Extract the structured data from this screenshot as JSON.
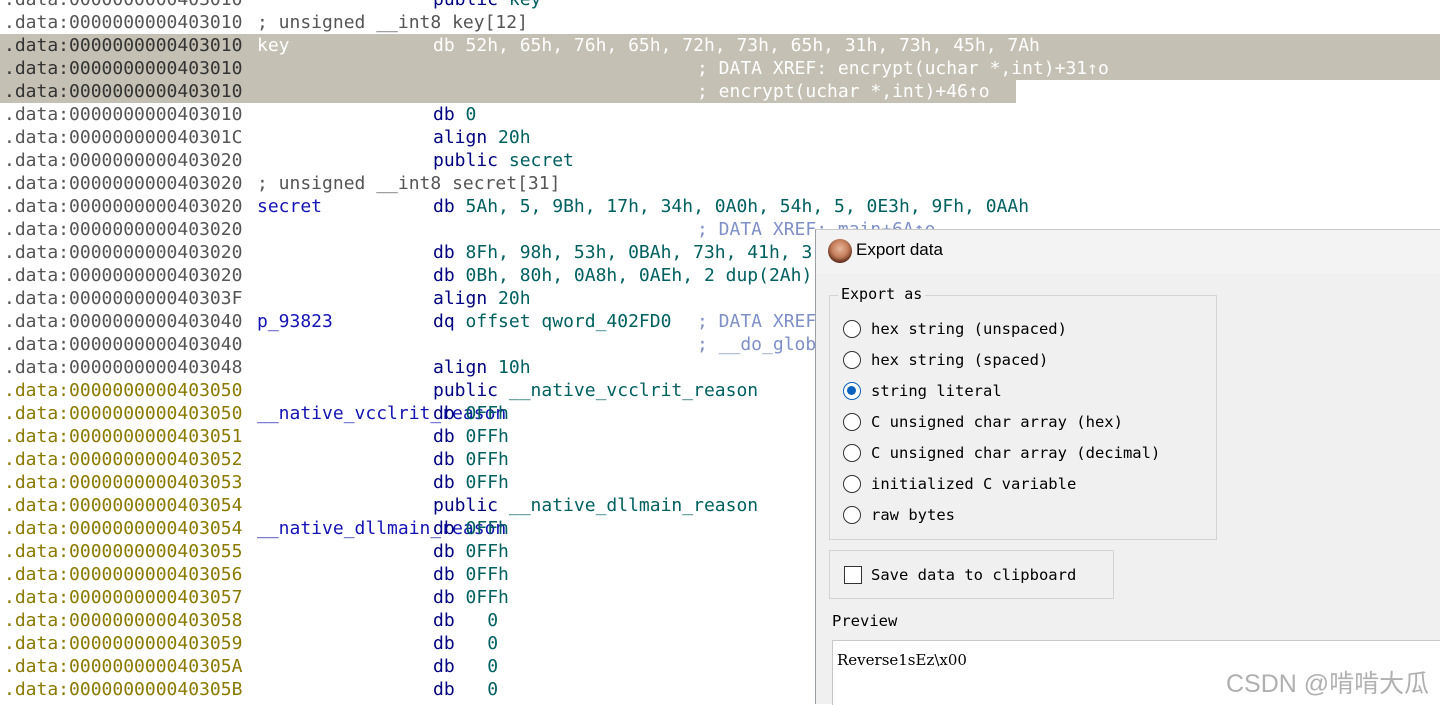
{
  "listing": {
    "lines": [
      {
        "addr": ".data:0000000000403010",
        "label": "",
        "decl": "",
        "ins": "public",
        "op": "key",
        "xref": ""
      },
      {
        "addr": ".data:0000000000403010",
        "label": "",
        "decl": "; unsigned __int8 key[12]",
        "ins": "",
        "op": "",
        "xref": ""
      },
      {
        "addr": ".data:0000000000403010",
        "label": "key",
        "decl": "",
        "ins": "db",
        "op": "52h, 65h, 76h, 65h, 72h, 73h, 65h, 31h, 73h, 45h, 7Ah",
        "xref": ""
      },
      {
        "addr": ".data:0000000000403010",
        "label": "",
        "decl": "",
        "ins": "",
        "op": "",
        "xref": "; DATA XREF: encrypt(uchar *,int)+31↑o"
      },
      {
        "addr": ".data:0000000000403010",
        "label": "",
        "decl": "",
        "ins": "",
        "op": "",
        "xref": "; encrypt(uchar *,int)+46↑o"
      },
      {
        "addr": ".data:0000000000403010",
        "label": "",
        "decl": "",
        "ins": "db",
        "op": "0",
        "xref": ""
      },
      {
        "addr": ".data:000000000040301C",
        "label": "",
        "decl": "",
        "ins": "align",
        "op": "20h",
        "xref": ""
      },
      {
        "addr": ".data:0000000000403020",
        "label": "",
        "decl": "",
        "ins": "public",
        "op": "secret",
        "xref": ""
      },
      {
        "addr": ".data:0000000000403020",
        "label": "",
        "decl": "; unsigned __int8 secret[31]",
        "ins": "",
        "op": "",
        "xref": ""
      },
      {
        "addr": ".data:0000000000403020",
        "label": "secret",
        "decl": "",
        "ins": "db",
        "op": "5Ah, 5, 9Bh, 17h, 34h, 0A0h, 54h, 5, 0E3h, 9Fh, 0AAh",
        "xref": ""
      },
      {
        "addr": ".data:0000000000403020",
        "label": "",
        "decl": "",
        "ins": "",
        "op": "",
        "xref": "; DATA XREF: main+6A↑o"
      },
      {
        "addr": ".data:0000000000403020",
        "label": "",
        "decl": "",
        "ins": "db",
        "op": "8Fh, 98h, 53h, 0BAh, 73h, 41h, 3",
        "xref": ""
      },
      {
        "addr": ".data:0000000000403020",
        "label": "",
        "decl": "",
        "ins": "db",
        "op": "0Bh, 80h, 0A8h, 0AEh, 2 dup(2Ah)",
        "xref": ""
      },
      {
        "addr": ".data:000000000040303F",
        "label": "",
        "decl": "",
        "ins": "align",
        "op": "20h",
        "xref": ""
      },
      {
        "addr": ".data:0000000000403040",
        "label": "p_93823",
        "decl": "",
        "ins": "dq",
        "op": "offset qword_402FD0",
        "xref": "; DATA XREF"
      },
      {
        "addr": ".data:0000000000403040",
        "label": "",
        "decl": "",
        "ins": "",
        "op": "",
        "xref": "; __do_glob"
      },
      {
        "addr": ".data:0000000000403048",
        "label": "",
        "decl": "",
        "ins": "align",
        "op": "10h",
        "xref": ""
      },
      {
        "addr": ".data:0000000000403050",
        "label": "",
        "decl": "",
        "ins": "public",
        "op": "__native_vcclrit_reason",
        "xref": ""
      },
      {
        "addr": ".data:0000000000403050",
        "label": "__native_vcclrit_reason",
        "decl": "",
        "ins": "db",
        "op": "0FFh",
        "xref": ""
      },
      {
        "addr": ".data:0000000000403051",
        "label": "",
        "decl": "",
        "ins": "db",
        "op": "0FFh",
        "xref": ""
      },
      {
        "addr": ".data:0000000000403052",
        "label": "",
        "decl": "",
        "ins": "db",
        "op": "0FFh",
        "xref": ""
      },
      {
        "addr": ".data:0000000000403053",
        "label": "",
        "decl": "",
        "ins": "db",
        "op": "0FFh",
        "xref": ""
      },
      {
        "addr": ".data:0000000000403054",
        "label": "",
        "decl": "",
        "ins": "public",
        "op": "__native_dllmain_reason",
        "xref": ""
      },
      {
        "addr": ".data:0000000000403054",
        "label": "__native_dllmain_reason",
        "decl": "",
        "ins": "db",
        "op": "0FFh",
        "xref": ""
      },
      {
        "addr": ".data:0000000000403055",
        "label": "",
        "decl": "",
        "ins": "db",
        "op": "0FFh",
        "xref": ""
      },
      {
        "addr": ".data:0000000000403056",
        "label": "",
        "decl": "",
        "ins": "db",
        "op": "0FFh",
        "xref": ""
      },
      {
        "addr": ".data:0000000000403057",
        "label": "",
        "decl": "",
        "ins": "db",
        "op": "0FFh",
        "xref": ""
      },
      {
        "addr": ".data:0000000000403058",
        "label": "",
        "decl": "",
        "ins": "db",
        "op": "  0",
        "xref": ""
      },
      {
        "addr": ".data:0000000000403059",
        "label": "",
        "decl": "",
        "ins": "db",
        "op": "  0",
        "xref": ""
      },
      {
        "addr": ".data:000000000040305A",
        "label": "",
        "decl": "",
        "ins": "db",
        "op": "  0",
        "xref": ""
      },
      {
        "addr": ".data:000000000040305B",
        "label": "",
        "decl": "",
        "ins": "db",
        "op": "  0",
        "xref": ""
      }
    ]
  },
  "dialog": {
    "title": "Export data",
    "export_as_label": "Export as",
    "options": [
      {
        "label": "hex string (unspaced)",
        "selected": false
      },
      {
        "label": "hex string (spaced)",
        "selected": false
      },
      {
        "label": "string literal",
        "selected": true
      },
      {
        "label": "C unsigned char array (hex)",
        "selected": false
      },
      {
        "label": "C unsigned char array (decimal)",
        "selected": false
      },
      {
        "label": "initialized C variable",
        "selected": false
      },
      {
        "label": "raw bytes",
        "selected": false
      }
    ],
    "clipboard_label": "Save data to clipboard",
    "clipboard_checked": false,
    "preview_label": "Preview",
    "preview_text": "Reverse1sEz\\x00"
  },
  "watermark": "CSDN @啃啃大瓜",
  "colors": {
    "selection": "#c4c0b3",
    "address": "#555555",
    "address_gold": "#8a7a00",
    "label": "#1414b4",
    "operand": "#006060",
    "xref": "#7f8fc8",
    "radio_selected": "#0a62c0"
  }
}
